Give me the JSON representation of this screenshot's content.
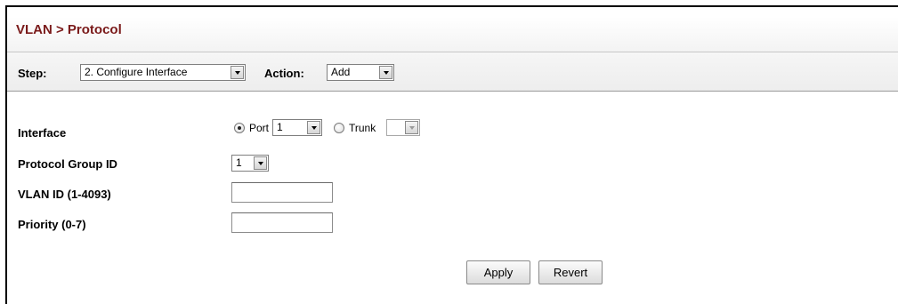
{
  "title": "VLAN > Protocol",
  "toolbar": {
    "step_label": "Step:",
    "step_value": "2. Configure Interface",
    "action_label": "Action:",
    "action_value": "Add"
  },
  "form": {
    "interface_label": "Interface",
    "port_label": "Port",
    "port_value": "1",
    "trunk_label": "Trunk",
    "trunk_value": "",
    "protocol_group_label": "Protocol Group ID",
    "protocol_group_value": "1",
    "vlan_id_label": "VLAN ID (1-4093)",
    "vlan_id_value": "",
    "priority_label": "Priority (0-7)",
    "priority_value": ""
  },
  "buttons": {
    "apply": "Apply",
    "revert": "Revert"
  }
}
